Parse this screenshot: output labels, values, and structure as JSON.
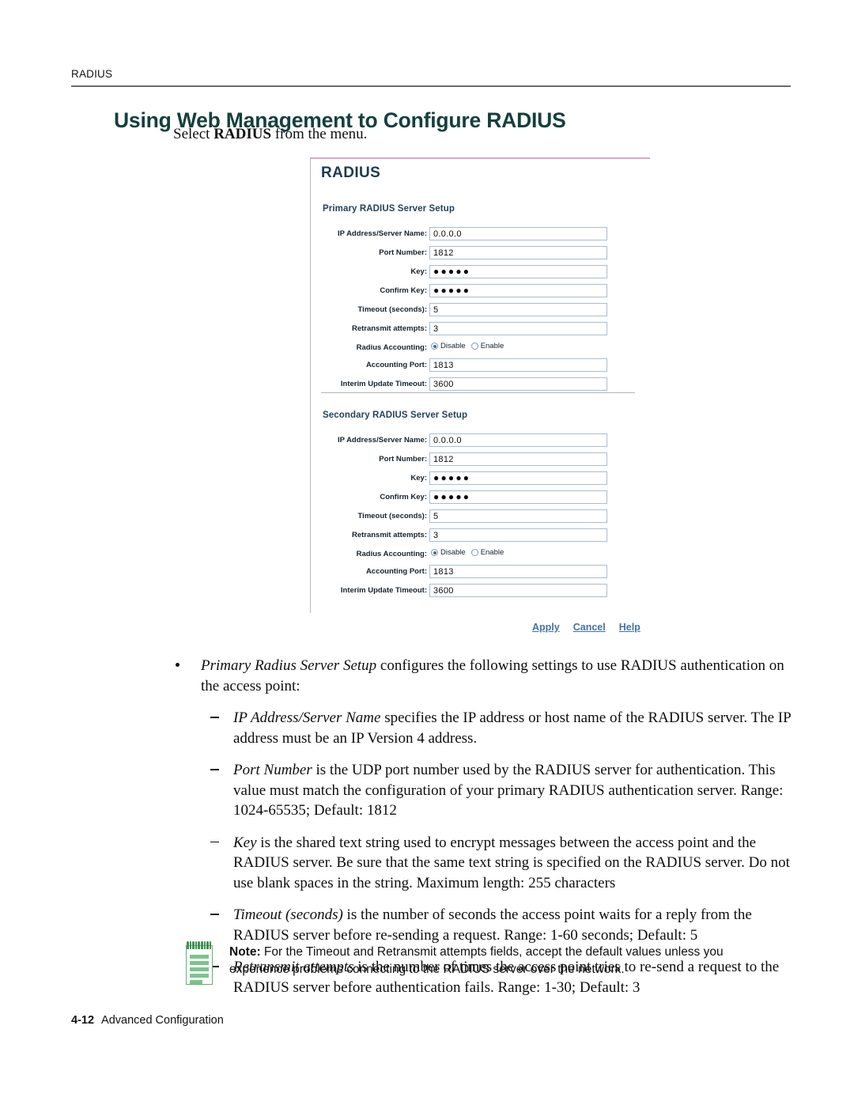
{
  "running_head": "RADIUS",
  "heading": "Using Web Management to Configure RADIUS",
  "lead_in": {
    "before": "Select ",
    "bold": "RADIUS",
    "after": " from the menu."
  },
  "panel": {
    "title": "RADIUS",
    "sections": [
      {
        "id": "primary",
        "title": "Primary RADIUS Server Setup",
        "fields": [
          {
            "label": "IP Address/Server Name:",
            "value": "0.0.0.0",
            "type": "text"
          },
          {
            "label": "Port Number:",
            "value": "1812",
            "type": "text"
          },
          {
            "label": "Key:",
            "value": "●●●●●",
            "type": "password"
          },
          {
            "label": "Confirm Key:",
            "value": "●●●●●",
            "type": "password"
          },
          {
            "label": "Timeout (seconds):",
            "value": "5",
            "type": "text"
          },
          {
            "label": "Retransmit attempts:",
            "value": "3",
            "type": "text"
          },
          {
            "label": "Radius Accounting:",
            "type": "radio",
            "options": [
              "Disable",
              "Enable"
            ],
            "selected": "Disable"
          },
          {
            "label": "Accounting Port:",
            "value": "1813",
            "type": "text"
          },
          {
            "label": "Interim Update Timeout:",
            "value": "3600",
            "type": "text"
          }
        ]
      },
      {
        "id": "secondary",
        "title": "Secondary RADIUS Server Setup",
        "fields": [
          {
            "label": "IP Address/Server Name:",
            "value": "0.0.0.0",
            "type": "text"
          },
          {
            "label": "Port Number:",
            "value": "1812",
            "type": "text"
          },
          {
            "label": "Key:",
            "value": "●●●●●",
            "type": "password"
          },
          {
            "label": "Confirm Key:",
            "value": "●●●●●",
            "type": "password"
          },
          {
            "label": "Timeout (seconds):",
            "value": "5",
            "type": "text"
          },
          {
            "label": "Retransmit attempts:",
            "value": "3",
            "type": "text"
          },
          {
            "label": "Radius Accounting:",
            "type": "radio",
            "options": [
              "Disable",
              "Enable"
            ],
            "selected": "Disable"
          },
          {
            "label": "Accounting Port:",
            "value": "1813",
            "type": "text"
          },
          {
            "label": "Interim Update Timeout:",
            "value": "3600",
            "type": "text"
          }
        ]
      }
    ],
    "actions": [
      {
        "label": "Apply",
        "name": "apply-link"
      },
      {
        "label": "Cancel",
        "name": "cancel-link"
      },
      {
        "label": "Help",
        "name": "help-link"
      }
    ],
    "colors": {
      "top_border": "#dba8c4",
      "title": "#1d3a4f",
      "link": "#4472a8",
      "input_border": "#a8bece"
    }
  },
  "body": {
    "bullet": {
      "italic": "Primary Radius Server Setup",
      "text": " configures the following settings to use RADIUS authentication on the access point:"
    },
    "sub_items": [
      {
        "italic": "IP Address/Server Name",
        "text": " specifies the IP address or host name of the RADIUS server. The IP address must be an IP Version 4 address."
      },
      {
        "italic": "Port Number",
        "text": " is the UDP port number used by the RADIUS server for authentication. This value must match the configuration of your primary RADIUS authentication server. Range: 1024-65535; Default: 1812"
      },
      {
        "italic": "Key",
        "text": " is the shared text string used to encrypt messages between the access point and the RADIUS server. Be sure that the same text string is specified on the RADIUS server. Do not use blank spaces in the string. Maximum length: 255 characters"
      },
      {
        "italic": "Timeout (seconds)",
        "text": " is the number of seconds the access point waits for a reply from the RADIUS server before re-sending a request. Range: 1-60 seconds; Default: 5"
      },
      {
        "italic": "Retransmit attempts",
        "text": " is the number of times the access point tries to re-send a request to the RADIUS server before authentication fails. Range: 1-30; Default: 3"
      }
    ]
  },
  "note": {
    "label": "Note:",
    "text": " For the Timeout and Retransmit attempts fields, accept the default values unless you experience problems connecting to the RADIUS server over the network."
  },
  "footer": {
    "page_number": "4-12",
    "section": "Advanced Configuration"
  }
}
